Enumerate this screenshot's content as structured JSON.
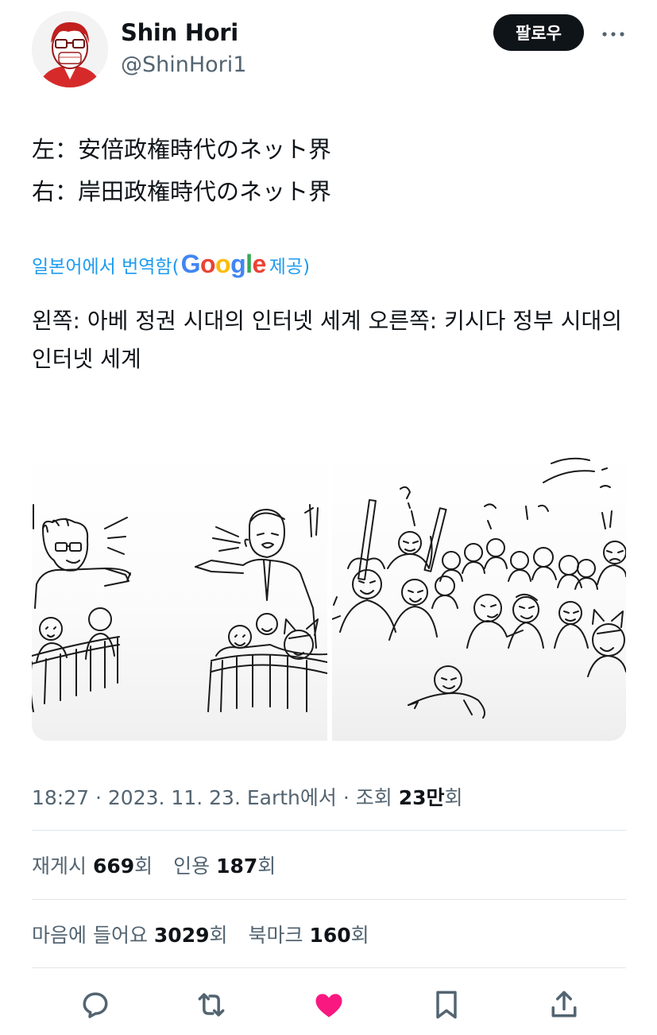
{
  "author": {
    "display_name": "Shin Hori",
    "handle": "@ShinHori1",
    "follow_label": "팔로우"
  },
  "tweet": {
    "lines": [
      "左：安倍政権時代のネット界",
      "右：岸田政権時代のネット界"
    ]
  },
  "translation": {
    "prefix": "일본어에서 번역함(",
    "provider": "Google",
    "suffix": " 제공)",
    "text": "왼쪽: 아베 정권 시대의 인터넷 세계 오른쪽: 키시다 정부 시대의 인터넷 세계"
  },
  "meta": {
    "time": "18:27",
    "date": "2023. 11. 23.",
    "source": "Earth에서",
    "views_label": "조회",
    "views_number": "23만",
    "views_suffix": "회"
  },
  "stats": {
    "reposts_label": "재게시",
    "reposts": "669",
    "quotes_label": "인용",
    "quotes": "187",
    "likes_label": "마음에 들어요",
    "likes": "3029",
    "bookmarks_label": "북마크",
    "bookmarks": "160",
    "count_suffix": "회"
  },
  "icons": {
    "reply": "reply-icon",
    "repost": "repost-icon",
    "like": "heart-icon",
    "bookmark": "bookmark-icon",
    "share": "share-icon",
    "more": "more-icon"
  },
  "colors": {
    "accent": "#1d9bf0",
    "like": "#f91880",
    "muted": "#536471",
    "text": "#0f1419"
  }
}
